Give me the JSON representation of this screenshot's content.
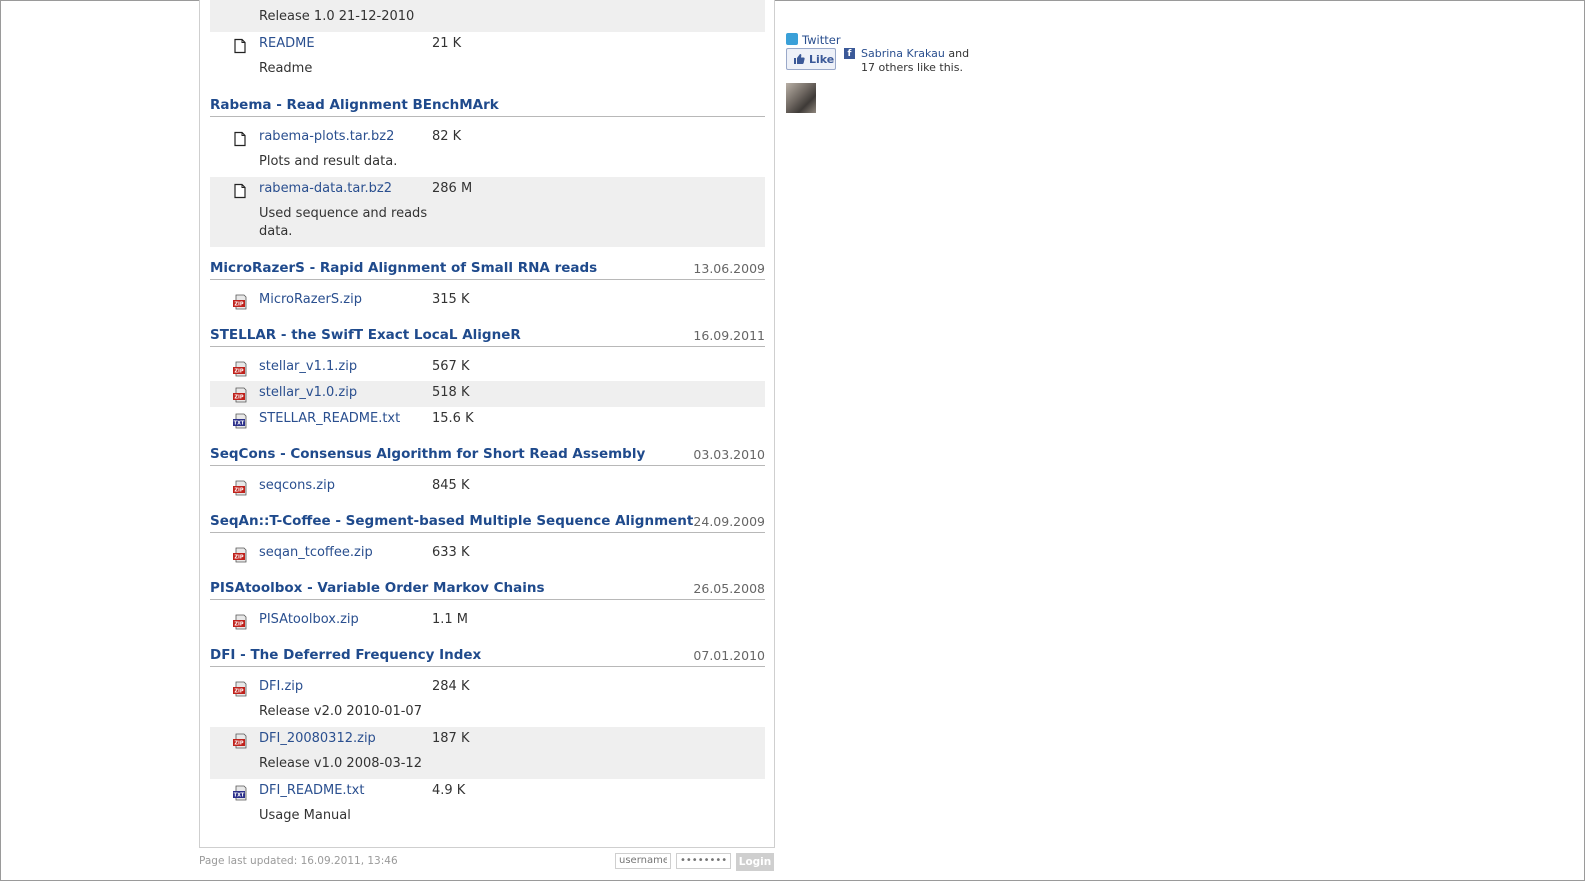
{
  "top_partial": {
    "desc": "Release 1.0 21-12-2010",
    "files": [
      {
        "name": "README",
        "size": "21 K",
        "desc": "Readme",
        "icon": "file-icon"
      }
    ]
  },
  "sections": [
    {
      "title": "Rabema - Read Alignment BEnchMArk",
      "date": "",
      "files": [
        {
          "name": "rabema-plots.tar.bz2",
          "size": "82 K",
          "desc": "Plots and result data.",
          "icon": "file-icon"
        },
        {
          "name": "rabema-data.tar.bz2",
          "size": "286 M",
          "desc": "Used sequence and reads data.",
          "icon": "file-icon"
        }
      ]
    },
    {
      "title": "MicroRazerS - Rapid Alignment of Small RNA reads",
      "date": "13.06.2009",
      "files": [
        {
          "name": "MicroRazerS.zip",
          "size": "315 K",
          "desc": "",
          "icon": "zip-icon"
        }
      ]
    },
    {
      "title": "STELLAR - the SwifT Exact LocaL AligneR",
      "date": "16.09.2011",
      "files": [
        {
          "name": "stellar_v1.1.zip",
          "size": "567 K",
          "desc": "",
          "icon": "zip-icon"
        },
        {
          "name": "stellar_v1.0.zip",
          "size": "518 K",
          "desc": "",
          "icon": "zip-icon"
        },
        {
          "name": "STELLAR_README.txt",
          "size": "15.6 K",
          "desc": "",
          "icon": "txt-icon"
        }
      ]
    },
    {
      "title": "SeqCons - Consensus Algorithm for Short Read Assembly",
      "date": "03.03.2010",
      "files": [
        {
          "name": "seqcons.zip",
          "size": "845 K",
          "desc": "",
          "icon": "zip-icon"
        }
      ]
    },
    {
      "title": "SeqAn::T-Coffee - Segment-based Multiple Sequence Alignment",
      "date": "24.09.2009",
      "files": [
        {
          "name": "seqan_tcoffee.zip",
          "size": "633 K",
          "desc": "",
          "icon": "zip-icon"
        }
      ]
    },
    {
      "title": "PISAtoolbox - Variable Order Markov Chains",
      "date": "26.05.2008",
      "files": [
        {
          "name": "PISAtoolbox.zip",
          "size": "1.1 M",
          "desc": "",
          "icon": "zip-icon"
        }
      ]
    },
    {
      "title": "DFI - The Deferred Frequency Index",
      "date": "07.01.2010",
      "files": [
        {
          "name": "DFI.zip",
          "size": "284 K",
          "desc": "Release v2.0 2010-01-07",
          "icon": "zip-icon"
        },
        {
          "name": "DFI_20080312.zip",
          "size": "187 K",
          "desc": "Release v1.0 2008-03-12",
          "icon": "zip-icon"
        },
        {
          "name": "DFI_README.txt",
          "size": "4.9 K",
          "desc": "Usage Manual",
          "icon": "txt-icon"
        }
      ]
    }
  ],
  "footer": {
    "last_updated": "Page last updated: 16.09.2011, 13:46",
    "username_placeholder": "username",
    "password_placeholder": "••••••••",
    "login_label": "Login"
  },
  "social": {
    "twitter_label": "Twitter",
    "like_label": "Like",
    "fb_name": "Sabrina Krakau",
    "fb_and": " and",
    "fb_others": "17 others like this."
  },
  "colors": {
    "link": "#2a4f8f",
    "section_title": "#1f4a8c",
    "alt_row": "#efefef",
    "zip_icon": "#c0211b",
    "txt_icon": "#2b2f8a"
  }
}
